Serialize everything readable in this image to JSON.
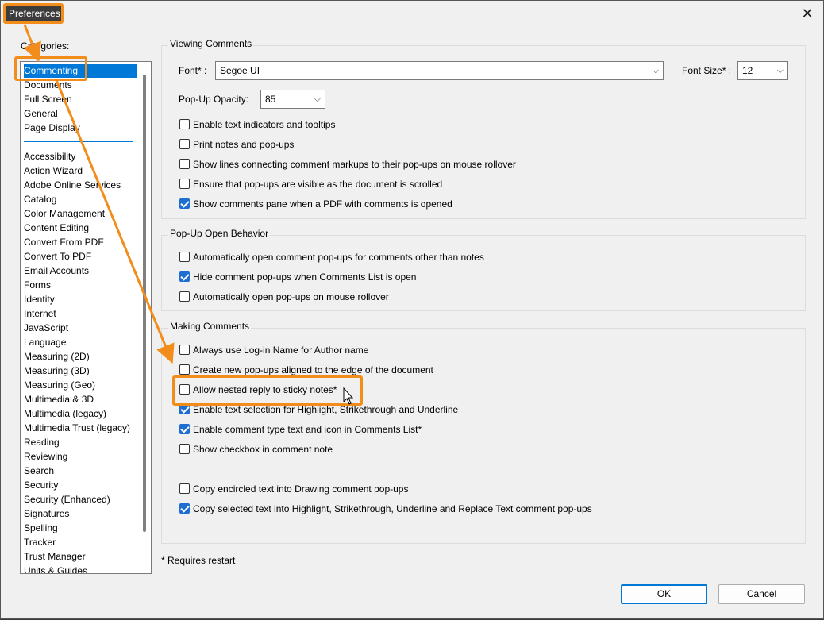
{
  "window": {
    "title": "Preferences",
    "close_icon": "close-icon"
  },
  "categories": {
    "label": "Categories:",
    "pinned": [
      "Commenting",
      "Documents",
      "Full Screen",
      "General",
      "Page Display"
    ],
    "selected": "Commenting",
    "items": [
      "Accessibility",
      "Action Wizard",
      "Adobe Online Services",
      "Catalog",
      "Color Management",
      "Content Editing",
      "Convert From PDF",
      "Convert To PDF",
      "Email Accounts",
      "Forms",
      "Identity",
      "Internet",
      "JavaScript",
      "Language",
      "Measuring (2D)",
      "Measuring (3D)",
      "Measuring (Geo)",
      "Multimedia & 3D",
      "Multimedia (legacy)",
      "Multimedia Trust (legacy)",
      "Reading",
      "Reviewing",
      "Search",
      "Security",
      "Security (Enhanced)",
      "Signatures",
      "Spelling",
      "Tracker",
      "Trust Manager",
      "Units & Guides"
    ]
  },
  "viewing": {
    "title": "Viewing Comments",
    "font_label": "Font*  :",
    "font_value": "Segoe UI",
    "font_size_label": "Font Size*  :",
    "font_size_value": "12",
    "opacity_label": "Pop-Up Opacity:",
    "opacity_value": "85",
    "options": [
      {
        "label": "Enable text indicators and tooltips",
        "checked": false
      },
      {
        "label": "Print notes and pop-ups",
        "checked": false
      },
      {
        "label": "Show lines connecting comment markups to their pop-ups on mouse rollover",
        "checked": false
      },
      {
        "label": "Ensure that pop-ups are visible as the document is scrolled",
        "checked": false
      },
      {
        "label": "Show comments pane when a PDF with comments is opened",
        "checked": true
      }
    ]
  },
  "popup": {
    "title": "Pop-Up Open Behavior",
    "options": [
      {
        "label": "Automatically open comment pop-ups for comments other than notes",
        "checked": false
      },
      {
        "label": "Hide comment pop-ups when Comments List is open",
        "checked": true
      },
      {
        "label": "Automatically open pop-ups on mouse rollover",
        "checked": false
      }
    ]
  },
  "making": {
    "title": "Making Comments",
    "options": [
      {
        "label": "Always use Log-in Name for Author name",
        "checked": false
      },
      {
        "label": "Create new pop-ups aligned to the edge of the document",
        "checked": false
      },
      {
        "label": "Allow nested reply to sticky notes*",
        "checked": false
      },
      {
        "label": "Enable text selection for Highlight, Strikethrough and Underline",
        "checked": true
      },
      {
        "label": "Enable comment type text and icon in Comments List*",
        "checked": true
      },
      {
        "label": "Show checkbox in comment note",
        "checked": false
      },
      {
        "label": "Copy encircled text into Drawing comment pop-ups",
        "checked": false
      },
      {
        "label": "Copy selected text into Highlight, Strikethrough, Underline and Replace Text comment pop-ups",
        "checked": true
      }
    ]
  },
  "footer": {
    "note": "* Requires restart",
    "ok": "OK",
    "cancel": "Cancel"
  },
  "colors": {
    "accent": "#0078d7",
    "highlight": "#f28c1a"
  }
}
